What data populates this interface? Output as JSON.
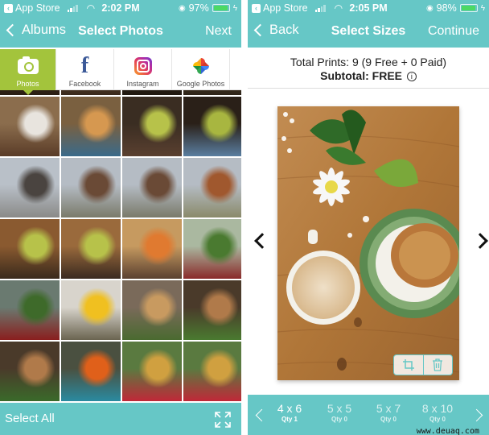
{
  "left": {
    "status": {
      "back_app": "App Store",
      "time": "2:02 PM",
      "battery": "97%",
      "battery_level": 0.97
    },
    "nav": {
      "back_label": "Albums",
      "title": "Select Photos",
      "next_label": "Next"
    },
    "sources": [
      {
        "label": "Photos",
        "icon": "camera-icon",
        "active": true
      },
      {
        "label": "Facebook",
        "icon": "facebook-icon",
        "active": false
      },
      {
        "label": "Instagram",
        "icon": "instagram-icon",
        "active": false
      },
      {
        "label": "Google Photos",
        "icon": "google-photos-icon",
        "active": false
      }
    ],
    "photos": [
      {
        "desc": "hotel-lobby",
        "c": [
          "#4a3522",
          "#8a6a48",
          "#2a1e14"
        ]
      },
      {
        "desc": "hotel-lobby",
        "c": [
          "#6d5236",
          "#b59b78",
          "#3a2a1c"
        ]
      },
      {
        "desc": "hotel-lobby",
        "c": [
          "#3a2a1c",
          "#6a5640",
          "#201810"
        ]
      },
      {
        "desc": "hotel-lobby",
        "c": [
          "#5a4530",
          "#9a8466",
          "#2e2418"
        ]
      },
      {
        "desc": "hotel-bedroom",
        "c": [
          "#8b6d4d",
          "#e8e4de",
          "#5a3c28"
        ]
      },
      {
        "desc": "lobby-lounge",
        "c": [
          "#7a6040",
          "#d69850",
          "#3a6a8a"
        ]
      },
      {
        "desc": "lobby-fireplace",
        "c": [
          "#3a2d22",
          "#b7c24a",
          "#5a4030"
        ]
      },
      {
        "desc": "lobby-chair",
        "c": [
          "#2a2018",
          "#a8b640",
          "#5a7ea0"
        ]
      },
      {
        "desc": "building-exterior",
        "c": [
          "#b9c0c8",
          "#4a4440",
          "#8a8a88"
        ]
      },
      {
        "desc": "building-exterior",
        "c": [
          "#b5bcc4",
          "#6a4a36",
          "#7a7a6a"
        ]
      },
      {
        "desc": "building-exterior",
        "c": [
          "#b5bcc4",
          "#6a4a36",
          "#7a7a6a"
        ]
      },
      {
        "desc": "building-exterior",
        "c": [
          "#b5bcc4",
          "#a0582e",
          "#8a8a6a"
        ]
      },
      {
        "desc": "lobby-seating",
        "c": [
          "#8a5a30",
          "#b7c24a",
          "#3a2a1c"
        ]
      },
      {
        "desc": "lobby-fireplace",
        "c": [
          "#9a6a3c",
          "#b7c24a",
          "#3a2a20"
        ]
      },
      {
        "desc": "lobby-lounge",
        "c": [
          "#c69a60",
          "#e07a30",
          "#5a4030"
        ]
      },
      {
        "desc": "market-tents",
        "c": [
          "#aab8a0",
          "#4a7a30",
          "#8a2a2a"
        ]
      },
      {
        "desc": "market-lawn",
        "c": [
          "#6a7a70",
          "#3e6a2a",
          "#8a1e1e"
        ]
      },
      {
        "desc": "market-sunflowers",
        "c": [
          "#d8d4cc",
          "#f0c020",
          "#6a6450"
        ]
      },
      {
        "desc": "market-produce",
        "c": [
          "#7a6a5a",
          "#c89a60",
          "#4a6a30"
        ]
      },
      {
        "desc": "market-crates",
        "c": [
          "#4a3a2a",
          "#b07a4a",
          "#4a7a30"
        ]
      },
      {
        "desc": "market-crates",
        "c": [
          "#4a3a2a",
          "#b07a4a",
          "#3a6a2a"
        ]
      },
      {
        "desc": "market-tomatoes",
        "c": [
          "#4a5040",
          "#e0601a",
          "#2a8aa0"
        ]
      },
      {
        "desc": "market-gingham",
        "c": [
          "#5a7a40",
          "#d0a040",
          "#c02838"
        ]
      },
      {
        "desc": "market-gingham",
        "c": [
          "#5a7a40",
          "#d0a040",
          "#c02838"
        ]
      }
    ],
    "bottom": {
      "select_all_label": "Select All"
    }
  },
  "right": {
    "status": {
      "back_app": "App Store",
      "time": "2:05 PM",
      "battery": "98%",
      "battery_level": 0.98
    },
    "nav": {
      "back_label": "Back",
      "title": "Select Sizes",
      "continue_label": "Continue"
    },
    "summary": {
      "total_line": "Total Prints: 9 (9 Free + 0 Paid)",
      "subtotal_line": "Subtotal: FREE",
      "info_glyph": "i"
    },
    "sizes": [
      {
        "size": "4 x 6",
        "qty": "Qty 1",
        "selected": true
      },
      {
        "size": "5 x 5",
        "qty": "Qty 0",
        "selected": false
      },
      {
        "size": "5 x 7",
        "qty": "Qty 0",
        "selected": false
      },
      {
        "size": "8 x 10",
        "qty": "Qty 0",
        "selected": false
      }
    ],
    "watermark": "www.deuaq.com"
  },
  "colors": {
    "brand_teal": "#66c7c6",
    "active_tab_green": "#a3c43c",
    "battery_green": "#4cd964"
  }
}
